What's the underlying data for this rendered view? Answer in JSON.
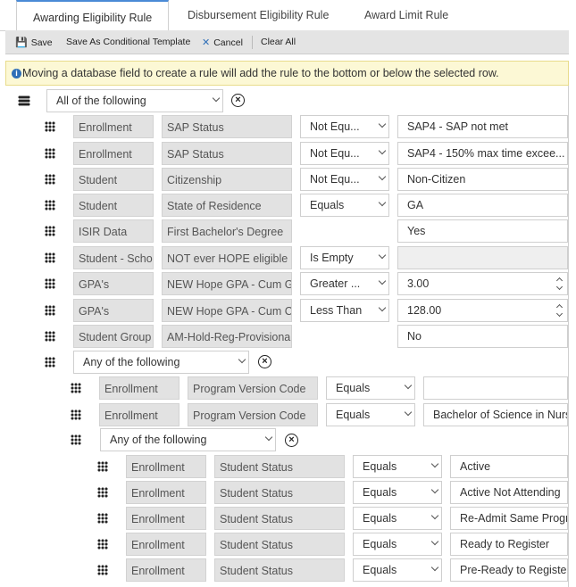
{
  "tabs": [
    "Awarding Eligibility Rule",
    "Disbursement Eligibility Rule",
    "Award Limit Rule"
  ],
  "toolbar": {
    "save": "Save",
    "save_template": "Save As Conditional Template",
    "cancel": "Cancel",
    "clear_all": "Clear All"
  },
  "info_message": "Moving a database field to create a rule will add the rule to the bottom or below the selected row.",
  "root_group": "All of the following",
  "rows": [
    {
      "entity": "Enrollment",
      "field": "SAP Status",
      "operator": "Not Equ...",
      "value": "SAP4 - SAP not met"
    },
    {
      "entity": "Enrollment",
      "field": "SAP Status",
      "operator": "Not Equ...",
      "value": "SAP4 - 150% max time excee..."
    },
    {
      "entity": "Student",
      "field": "Citizenship",
      "operator": "Not Equ...",
      "value": "Non-Citizen"
    },
    {
      "entity": "Student",
      "field": "State of Residence",
      "operator": "Equals",
      "value": "GA"
    },
    {
      "entity": "ISIR Data",
      "field": "First Bachelor's Degree",
      "operator": "",
      "value": "Yes"
    },
    {
      "entity": "Student - Scho",
      "field": "NOT ever HOPE eligible",
      "operator": "Is Empty",
      "value": ""
    },
    {
      "entity": "GPA's",
      "field": "NEW Hope GPA - Cum GP",
      "operator": "Greater ...",
      "value": "3.00"
    },
    {
      "entity": "GPA's",
      "field": "NEW Hope GPA - Cum Cr",
      "operator": "Less Than",
      "value": "128.00"
    },
    {
      "entity": "Student Group",
      "field": "AM-Hold-Reg-Provisional",
      "operator": "",
      "value": "No"
    }
  ],
  "group1": {
    "label": "Any of the following",
    "rows": [
      {
        "entity": "Enrollment",
        "field": "Program Version Code",
        "operator": "Equals",
        "value": ""
      },
      {
        "entity": "Enrollment",
        "field": "Program Version Code",
        "operator": "Equals",
        "value": "Bachelor of Science in Nurs"
      }
    ]
  },
  "group2": {
    "label": "Any of the following",
    "rows": [
      {
        "entity": "Enrollment",
        "field": "Student Status",
        "operator": "Equals",
        "value": "Active"
      },
      {
        "entity": "Enrollment",
        "field": "Student Status",
        "operator": "Equals",
        "value": "Active Not Attending"
      },
      {
        "entity": "Enrollment",
        "field": "Student Status",
        "operator": "Equals",
        "value": "Re-Admit Same Progra"
      },
      {
        "entity": "Enrollment",
        "field": "Student Status",
        "operator": "Equals",
        "value": "Ready to Register"
      },
      {
        "entity": "Enrollment",
        "field": "Student Status",
        "operator": "Equals",
        "value": "Pre-Ready to Register"
      }
    ]
  }
}
